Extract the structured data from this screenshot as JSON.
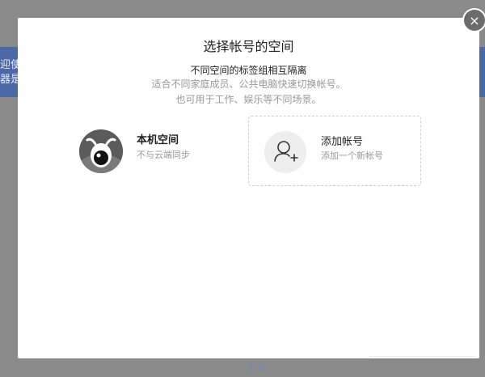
{
  "modal": {
    "title": "选择帐号的空间",
    "subtitle": "不同空间的标签组相互隔离",
    "description_lines": [
      "适合不同家庭成员、公共电脑快速切换帐号。",
      "也可用于工作、娱乐等不同场景。"
    ],
    "close_icon": "×"
  },
  "cards": {
    "local": {
      "name": "本机空间",
      "sub": "不与云端同步",
      "icon": "logo-avatar"
    },
    "add": {
      "name": "添加帐号",
      "sub": "添加一个新帐号",
      "icon": "add-user-icon"
    }
  },
  "background": {
    "side_text": [
      "迎使",
      "器是"
    ],
    "footer_text": "1 >"
  },
  "colors": {
    "overlay": "#8a8a8a",
    "band": "#4b67a6",
    "muted_text": "#999999"
  }
}
